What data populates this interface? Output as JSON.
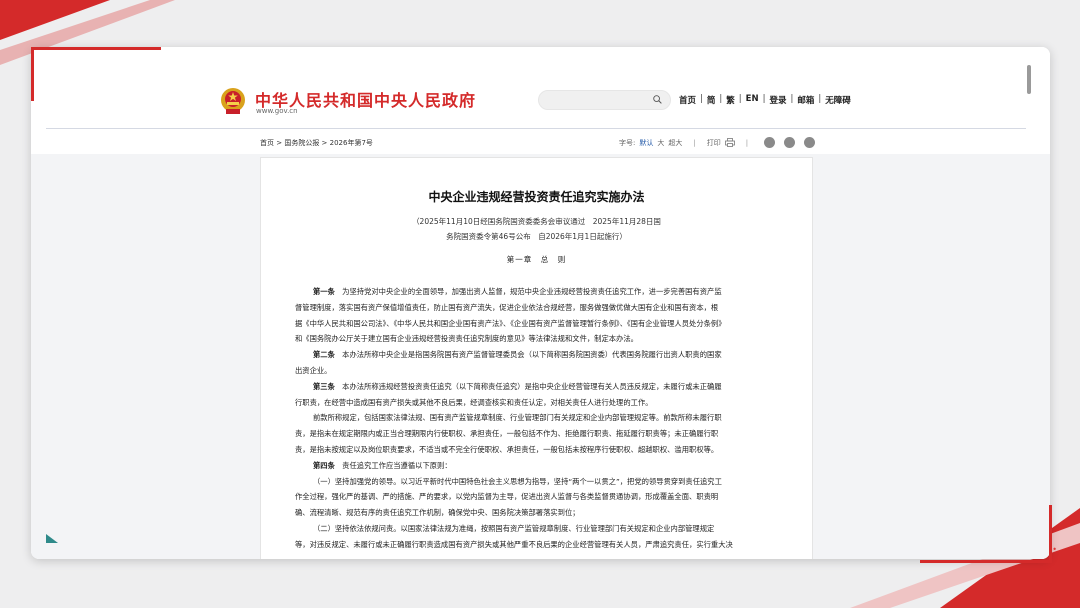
{
  "site": {
    "title": "中华人民共和国中央人民政府",
    "url": "www.gov.cn",
    "search_placeholder": ""
  },
  "top_nav": [
    "首页",
    "简",
    "繁",
    "EN",
    "登录",
    "邮箱",
    "无障碍"
  ],
  "breadcrumb": "首页 > 国务院公报 > 2026年第7号",
  "tools": {
    "font_label": "字号:",
    "font_default": "默认",
    "font_large": "大",
    "font_xlarge": "超大",
    "print_label": "打印"
  },
  "icons": {
    "search": "search-icon",
    "print": "printer-icon",
    "weibo": "weibo-icon",
    "wechat": "wechat-icon",
    "share": "share-icon",
    "emblem": "national-emblem-icon"
  },
  "colors": {
    "brand_red": "#d42a2a",
    "link_blue": "#2359a8"
  },
  "document": {
    "title": "中央企业违规经营投资责任追究实施办法",
    "sub1": "（2025年11月10日经国务院国资委委务会审议通过　2025年11月28日国",
    "sub2": "务院国资委令第46号公布　自2026年1月1日起施行）",
    "chapter": "第一章　总　则",
    "lines": [
      {
        "lead": "第一条",
        "text": "　为坚持党对中央企业的全面领导，加强出资人监督，规范中央企业违规经营投资责任追究工作，进一步完善国有资产监"
      },
      {
        "lead": "",
        "text": "督管理制度，落实国有资产保值增值责任，防止国有资产流失，促进企业依法合规经营，服务做强做优做大国有企业和国有资本，根"
      },
      {
        "lead": "",
        "text": "据《中华人民共和国公司法》、《中华人民共和国企业国有资产法》、《企业国有资产监督管理暂行条例》、《国有企业管理人员处分条例》"
      },
      {
        "lead": "",
        "text": "和《国务院办公厅关于建立国有企业违规经营投资责任追究制度的意见》等法律法规和文件，制定本办法。"
      },
      {
        "lead": "第二条",
        "text": "　本办法所称中央企业是指国务院国有资产监督管理委员会（以下简称国务院国资委）代表国务院履行出资人职责的国家"
      },
      {
        "lead": "",
        "text": "出资企业。"
      },
      {
        "lead": "第三条",
        "text": "　本办法所称违规经营投资责任追究（以下简称责任追究）是指中央企业经营管理有关人员违反规定，未履行或未正确履"
      },
      {
        "lead": "",
        "text": "行职责，在经营中造成国有资产损失或其他不良后果，经调查核实和责任认定，对相关责任人进行处理的工作。"
      },
      {
        "lead": "",
        "text": "前款所称规定，包括国家法律法规、国有资产监管规章制度、行业管理部门有关规定和企业内部管理规定等。前款所称未履行职"
      },
      {
        "lead": "",
        "text": "责，是指未在规定期限内或正当合理期限内行使职权、承担责任，一般包括不作为、拒绝履行职责、拖延履行职责等；未正确履行职"
      },
      {
        "lead": "",
        "text": "责，是指未按规定以及岗位职责要求，不适当或不完全行使职权、承担责任，一般包括未按程序行使职权、超越职权、滥用职权等。"
      },
      {
        "lead": "第四条",
        "text": "　责任追究工作应当遵循以下原则："
      },
      {
        "lead": "",
        "text": "（一）坚持加强党的领导。以习近平新时代中国特色社会主义思想为指导，坚持“两个一以贯之”，把党的领导贯穿到责任追究工"
      },
      {
        "lead": "",
        "text": "作全过程，强化严的基调、严的措施、严的要求，以党内监督为主导，促进出资人监督与各类监督贯通协调，形成覆盖全面、职责明"
      },
      {
        "lead": "",
        "text": "确、流程清晰、规范有序的责任追究工作机制，确保党中央、国务院决策部署落实到位；"
      },
      {
        "lead": "",
        "text": "（二）坚持依法依规问责。以国家法律法规为准绳，按照国有资产监管规章制度、行业管理部门有关规定和企业内部管理规定"
      },
      {
        "lead": "",
        "text": "等，对违反规定、未履行或未正确履行职责造成国有资产损失或其他严重不良后果的企业经营管理有关人员，严肃追究责任，实行重大决"
      }
    ]
  }
}
